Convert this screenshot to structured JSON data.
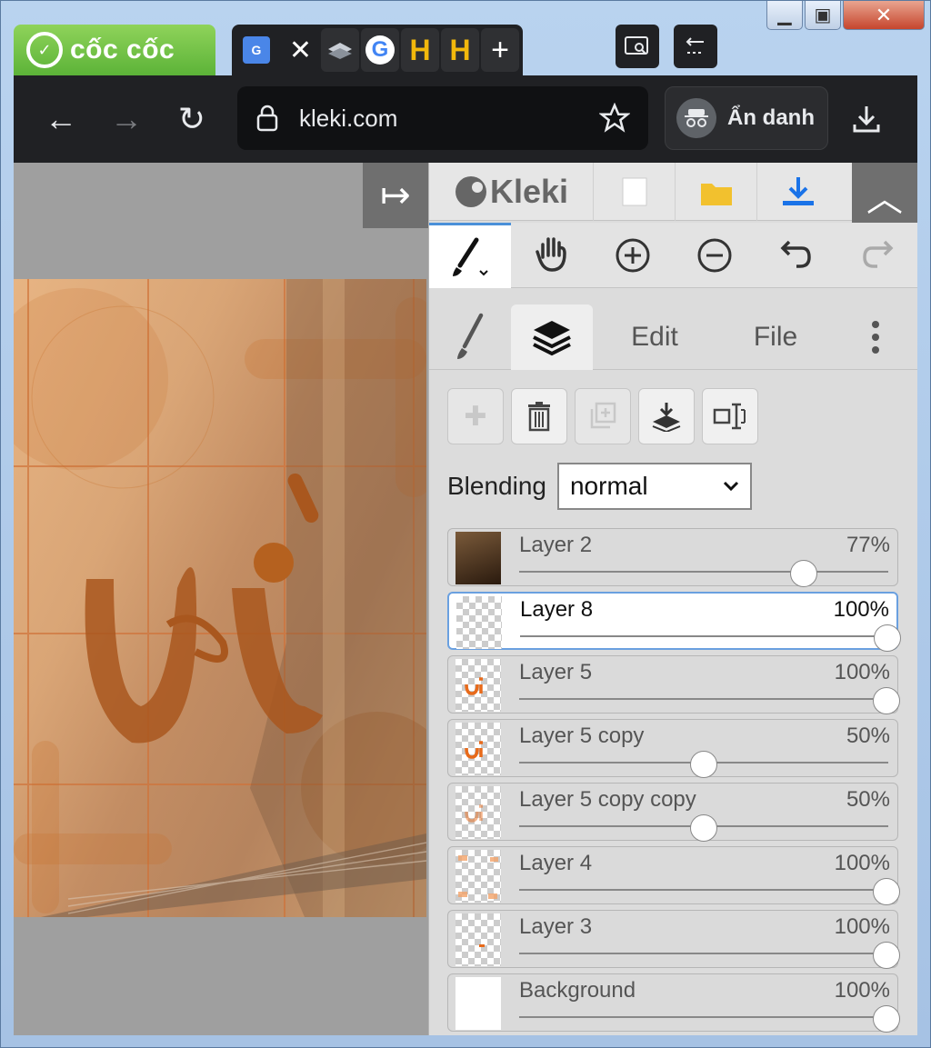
{
  "browser": {
    "brand": "cốc cốc",
    "tabs": [
      {
        "icon": "translate-icon",
        "active": true
      },
      {
        "icon": "layers-icon"
      },
      {
        "icon": "google-icon",
        "glyph": "G"
      },
      {
        "icon": "h-icon",
        "glyph": "H"
      },
      {
        "icon": "h-icon",
        "glyph": "H"
      }
    ],
    "new_tab_glyph": "+",
    "close_glyph": "✕",
    "url": "kleki.com",
    "incognito_label": "Ẩn danh"
  },
  "app": {
    "logo": "Kleki",
    "panel_tabs": [
      "Edit",
      "File"
    ],
    "blending_label": "Blending",
    "blending_value": "normal",
    "layers": [
      {
        "name": "Layer 2",
        "opacity": "77%",
        "value": 0.77,
        "thumb": "photo"
      },
      {
        "name": "Layer 8",
        "opacity": "100%",
        "value": 1.0,
        "thumb": "empty",
        "selected": true
      },
      {
        "name": "Layer 5",
        "opacity": "100%",
        "value": 1.0,
        "thumb": "text"
      },
      {
        "name": "Layer 5 copy",
        "opacity": "50%",
        "value": 0.5,
        "thumb": "text"
      },
      {
        "name": "Layer 5 copy copy",
        "opacity": "50%",
        "value": 0.5,
        "thumb": "text-faint"
      },
      {
        "name": "Layer 4",
        "opacity": "100%",
        "value": 1.0,
        "thumb": "corners"
      },
      {
        "name": "Layer 3",
        "opacity": "100%",
        "value": 1.0,
        "thumb": "dot"
      },
      {
        "name": "Background",
        "opacity": "100%",
        "value": 1.0,
        "thumb": "white"
      }
    ]
  },
  "colors": {
    "accent": "#4a90d9",
    "canvas_orange": "#c8702c",
    "brand_green": "#6cc142"
  }
}
